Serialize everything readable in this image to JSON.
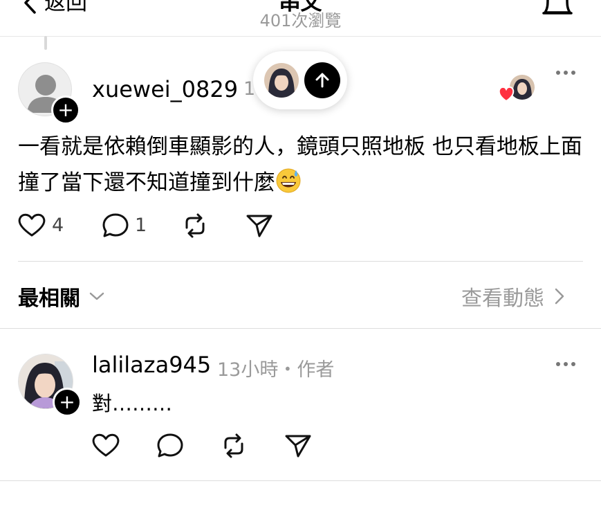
{
  "header": {
    "back_label": "返回",
    "title": "串文",
    "views": "401次瀏覽"
  },
  "post": {
    "username": "xuewei_0829",
    "time_fragment": "1",
    "text": "一看就是依賴倒車顯影的人，鏡頭只照地板 也只看地板上面撞了當下還不知道撞到什麼",
    "like_count": "4",
    "comment_count": "1"
  },
  "sort": {
    "label": "最相關",
    "activity_link": "查看動態"
  },
  "reply": {
    "username": "lalilaza945",
    "meta": "13小時・作者",
    "text": "對………"
  },
  "icons": {
    "back": "chevron-left-icon",
    "bell": "bell-icon",
    "like": "heart-icon",
    "comment": "comment-icon",
    "repost": "repost-icon",
    "share": "send-icon",
    "more": "more-dots-icon",
    "scroll_up": "arrow-up-icon",
    "sweat_emoji": "grinning-sweat-emoji"
  },
  "colors": {
    "accent": "#000000",
    "muted_text": "#9a9a9a",
    "liked_heart": "#ff3040",
    "divider": "#dddddd"
  }
}
